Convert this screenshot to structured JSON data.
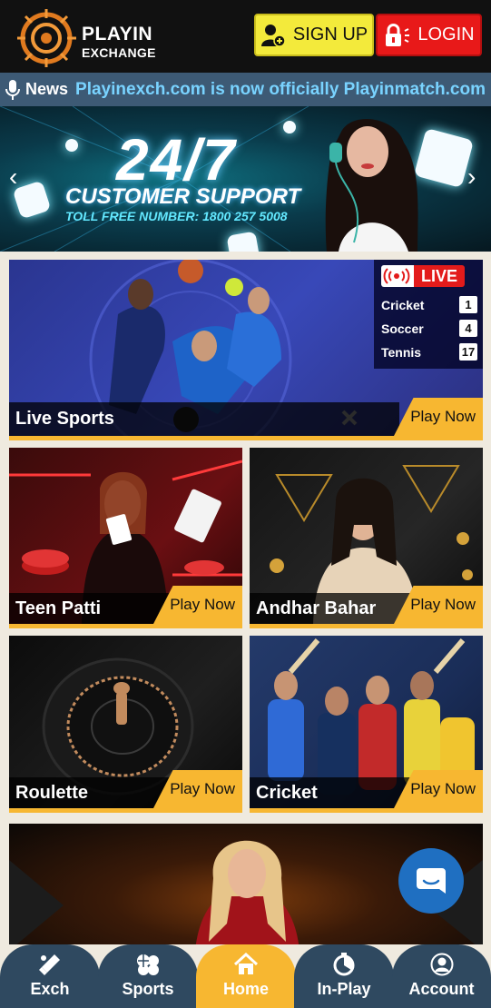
{
  "header": {
    "logo_line1": "PLAYIN",
    "logo_line2": "EXCHANGE",
    "signup_label": "SIGN UP",
    "login_label": "LOGIN"
  },
  "news": {
    "label": "News",
    "text": "Playinexch.com is now officially Playinmatch.com !"
  },
  "banner": {
    "headline": "24/7",
    "subheadline": "CUSTOMER SUPPORT",
    "tollfree": "TOLL FREE NUMBER: 1800 257 5008"
  },
  "live_sports": {
    "label": "Live Sports",
    "play_label": "Play Now",
    "live_badge": "LIVE",
    "rows": [
      {
        "name": "Cricket",
        "count": "1"
      },
      {
        "name": "Soccer",
        "count": "4"
      },
      {
        "name": "Tennis",
        "count": "17"
      }
    ]
  },
  "games": [
    {
      "label": "Teen Patti",
      "play_label": "Play Now"
    },
    {
      "label": "Andhar Bahar",
      "play_label": "Play Now"
    },
    {
      "label": "Roulette",
      "play_label": "Play Now"
    },
    {
      "label": "Cricket",
      "play_label": "Play Now"
    }
  ],
  "bottom_nav": [
    {
      "label": "Exch",
      "icon": "cricket-bat-icon"
    },
    {
      "label": "Sports",
      "icon": "sports-balls-icon"
    },
    {
      "label": "Home",
      "icon": "home-icon"
    },
    {
      "label": "In-Play",
      "icon": "timer-icon"
    },
    {
      "label": "Account",
      "icon": "user-icon"
    }
  ],
  "colors": {
    "accent": "#f7b731",
    "nav": "#2f4960",
    "news_bg": "#3d5a75",
    "news_text": "#79d3ff",
    "signup": "#f3ea3b",
    "login": "#e81919",
    "live": "#e31b1b",
    "chat": "#1f6fc1"
  }
}
